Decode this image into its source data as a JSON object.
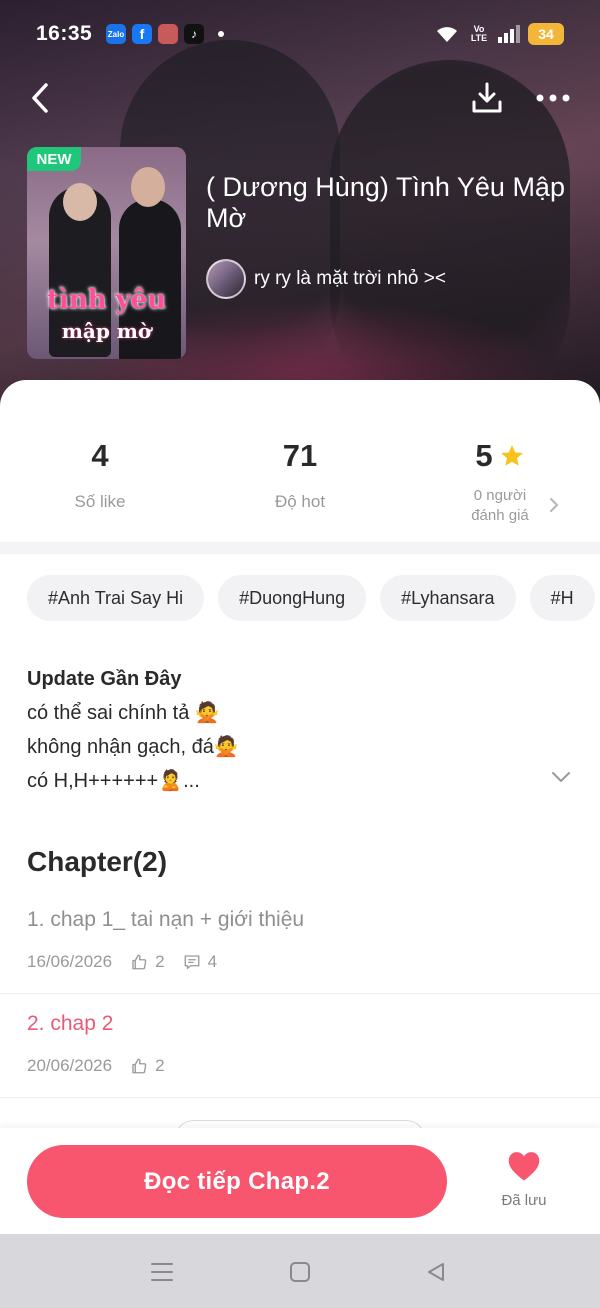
{
  "status_bar": {
    "time": "16:35",
    "apps": [
      {
        "name": "zalo-icon",
        "label": "Zalo",
        "color": "#1a73e8"
      },
      {
        "name": "facebook-icon",
        "label": "f",
        "color": "#1877f2"
      },
      {
        "name": "photo-app-icon",
        "label": "",
        "color": "#c85a5a"
      },
      {
        "name": "tiktok-icon",
        "label": "♪",
        "color": "#111111"
      }
    ],
    "volte": "Vo LTE",
    "battery": "34"
  },
  "header": {
    "new_badge": "NEW",
    "cover_title_line1": "tình yêu",
    "cover_title_line2": "mập mờ",
    "title": "( Dương Hùng) Tình Yêu Mập Mờ",
    "author": "ry ry là mặt trời nhỏ ><"
  },
  "stats": {
    "likes_value": "4",
    "likes_label": "Số like",
    "hot_value": "71",
    "hot_label": "Độ hot",
    "rating_value": "5",
    "rating_label_line1": "0 người",
    "rating_label_line2": "đánh giá"
  },
  "tags": [
    "#Anh Trai Say Hi",
    "#DuongHung",
    "#Lyhansara",
    "#H"
  ],
  "description": {
    "heading": "Update Gần Đây",
    "lines": [
      "có thể sai chính tả 🙅",
      "không nhận gạch, đá🙅",
      "có H,H++++++🙎..."
    ]
  },
  "chapters": {
    "heading": "Chapter(2)",
    "items": [
      {
        "title": "1. chap 1_ tai nạn + giới thiệu",
        "date": "16/06/2026",
        "likes": "2",
        "comments": "4"
      },
      {
        "title": "2. chap 2",
        "date": "20/06/2026",
        "likes": "2"
      }
    ]
  },
  "bottom": {
    "read_button": "Đọc tiếp Chap.2",
    "save_label": "Đã lưu"
  },
  "colors": {
    "accent": "#f7566e",
    "active_chapter": "#e85a78",
    "star": "#f7c21a",
    "new_badge": "#1fc77a"
  }
}
